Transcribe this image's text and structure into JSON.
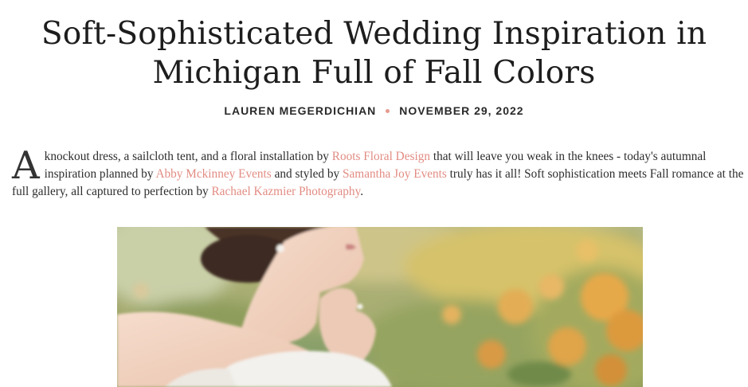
{
  "article": {
    "title_line1": "Soft-Sophisticated Wedding Inspiration in",
    "title_line2": "Michigan Full of Fall Colors",
    "author": "LAUREN MEGERDICHIAN",
    "date": "NOVEMBER 29, 2022",
    "intro": {
      "dropcap": "A",
      "t1": " knockout dress, a sailcloth tent, and a floral installation by ",
      "link1": "Roots Floral Design",
      "t2": " that will leave you weak in the knees - today's autumnal inspiration planned by ",
      "link2": "Abby Mckinney Events",
      "t3": " and styled by ",
      "link3": "Samantha Joy Events",
      "t4": " truly has it all! Soft sophistication meets Fall romance at the full gallery, all captured to perfection by ",
      "link4": "Rachael Kazmier Photography",
      "t5": "."
    }
  },
  "colors": {
    "link": "#e28c83",
    "dot": "#e59a8e"
  }
}
